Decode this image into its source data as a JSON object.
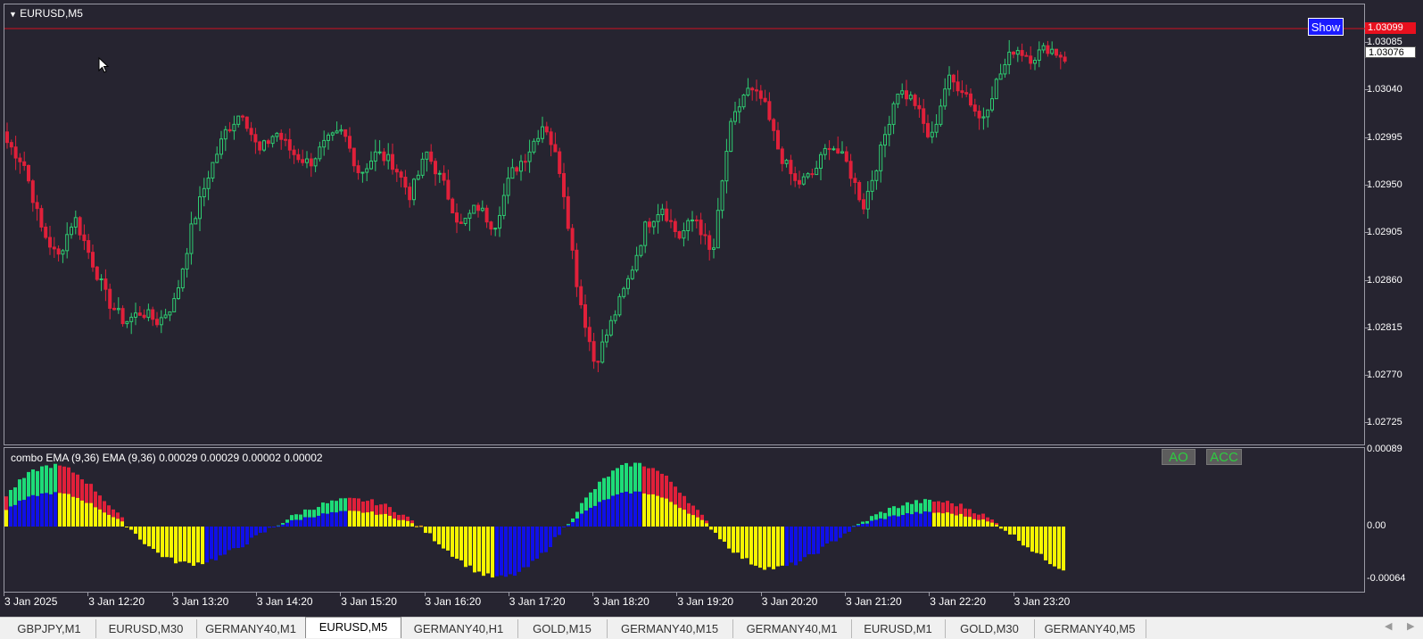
{
  "main_chart": {
    "title": "EURUSD,M5",
    "price_levels": [
      "1.03085",
      "1.03040",
      "1.02995",
      "1.02950",
      "1.02905",
      "1.02860",
      "1.02815",
      "1.02770",
      "1.02725"
    ],
    "current_price_red": "1.03099",
    "current_price_white": "1.03076",
    "show_button": "Show",
    "colors": {
      "up": "#2ecc71",
      "down": "#e0203a",
      "hline": "#d01020",
      "background": "#262430"
    }
  },
  "indicator": {
    "title": "combo EMA (9,36) EMA (9,36)  0.00029 0.00029 0.00002 0.00002",
    "levels": [
      "0.00089",
      "0.00",
      "-0.00064"
    ],
    "ao_label": "AO",
    "acc_label": "ACC",
    "colors": {
      "green": "#1ddc78",
      "red": "#e0203a",
      "blue": "#1010e8",
      "yellow": "#f5f500"
    }
  },
  "time_axis": [
    "3 Jan 2025",
    "3 Jan 12:20",
    "3 Jan 13:20",
    "3 Jan 14:20",
    "3 Jan 15:20",
    "3 Jan 16:20",
    "3 Jan 17:20",
    "3 Jan 18:20",
    "3 Jan 19:20",
    "3 Jan 20:20",
    "3 Jan 21:20",
    "3 Jan 22:20",
    "3 Jan 23:20"
  ],
  "tabs": [
    "GBPJPY,M1",
    "EURUSD,M30",
    "GERMANY40,M1",
    "EURUSD,M5",
    "GERMANY40,H1",
    "GOLD,M15",
    "GERMANY40,M15",
    "GERMANY40,M1",
    "EURUSD,M1",
    "GOLD,M30",
    "GERMANY40,M5"
  ],
  "active_tab": "EURUSD,M5",
  "chart_data": {
    "type": "candlestick",
    "symbol": "EURUSD,M5",
    "close_path": [
      1.0299,
      1.0297,
      1.0291,
      1.0288,
      1.0292,
      1.0288,
      1.0284,
      1.0282,
      1.0283,
      1.0282,
      1.0284,
      1.0291,
      1.0296,
      1.03,
      1.0302,
      1.0298,
      1.03,
      1.0298,
      1.0297,
      1.0299,
      1.03,
      1.0296,
      1.0298,
      1.0297,
      1.0294,
      1.0298,
      1.0295,
      1.0291,
      1.0293,
      1.0291,
      1.0296,
      1.0298,
      1.0301,
      1.0296,
      1.0285,
      1.0278,
      1.0282,
      1.0286,
      1.0291,
      1.0293,
      1.029,
      1.0292,
      1.0288,
      1.03,
      1.0304,
      1.0303,
      1.0298,
      1.0295,
      1.0296,
      1.0299,
      1.0297,
      1.0293,
      1.0298,
      1.0304,
      1.0303,
      1.0299,
      1.0305,
      1.0304,
      1.0301,
      1.0305,
      1.0308,
      1.0307,
      1.0308,
      1.0307
    ]
  }
}
